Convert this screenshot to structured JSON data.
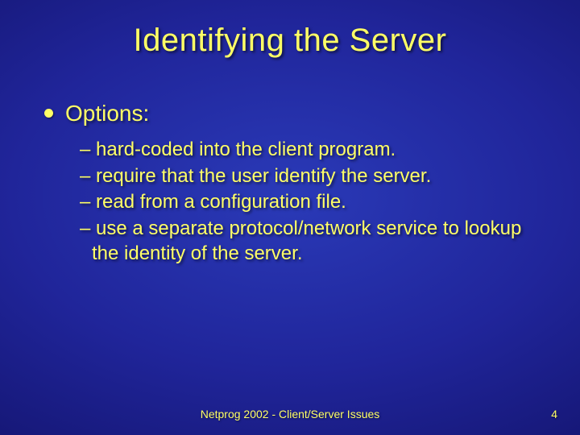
{
  "slide": {
    "title": "Identifying the Server",
    "bullets": [
      {
        "label": "Options:",
        "subs": [
          "– hard-coded into the client program.",
          "– require that the user identify the server.",
          "– read from a configuration file.",
          "– use a separate protocol/network service to lookup the identity of the server."
        ]
      }
    ]
  },
  "footer": {
    "center": "Netprog 2002 - Client/Server Issues",
    "page_number": "4"
  }
}
